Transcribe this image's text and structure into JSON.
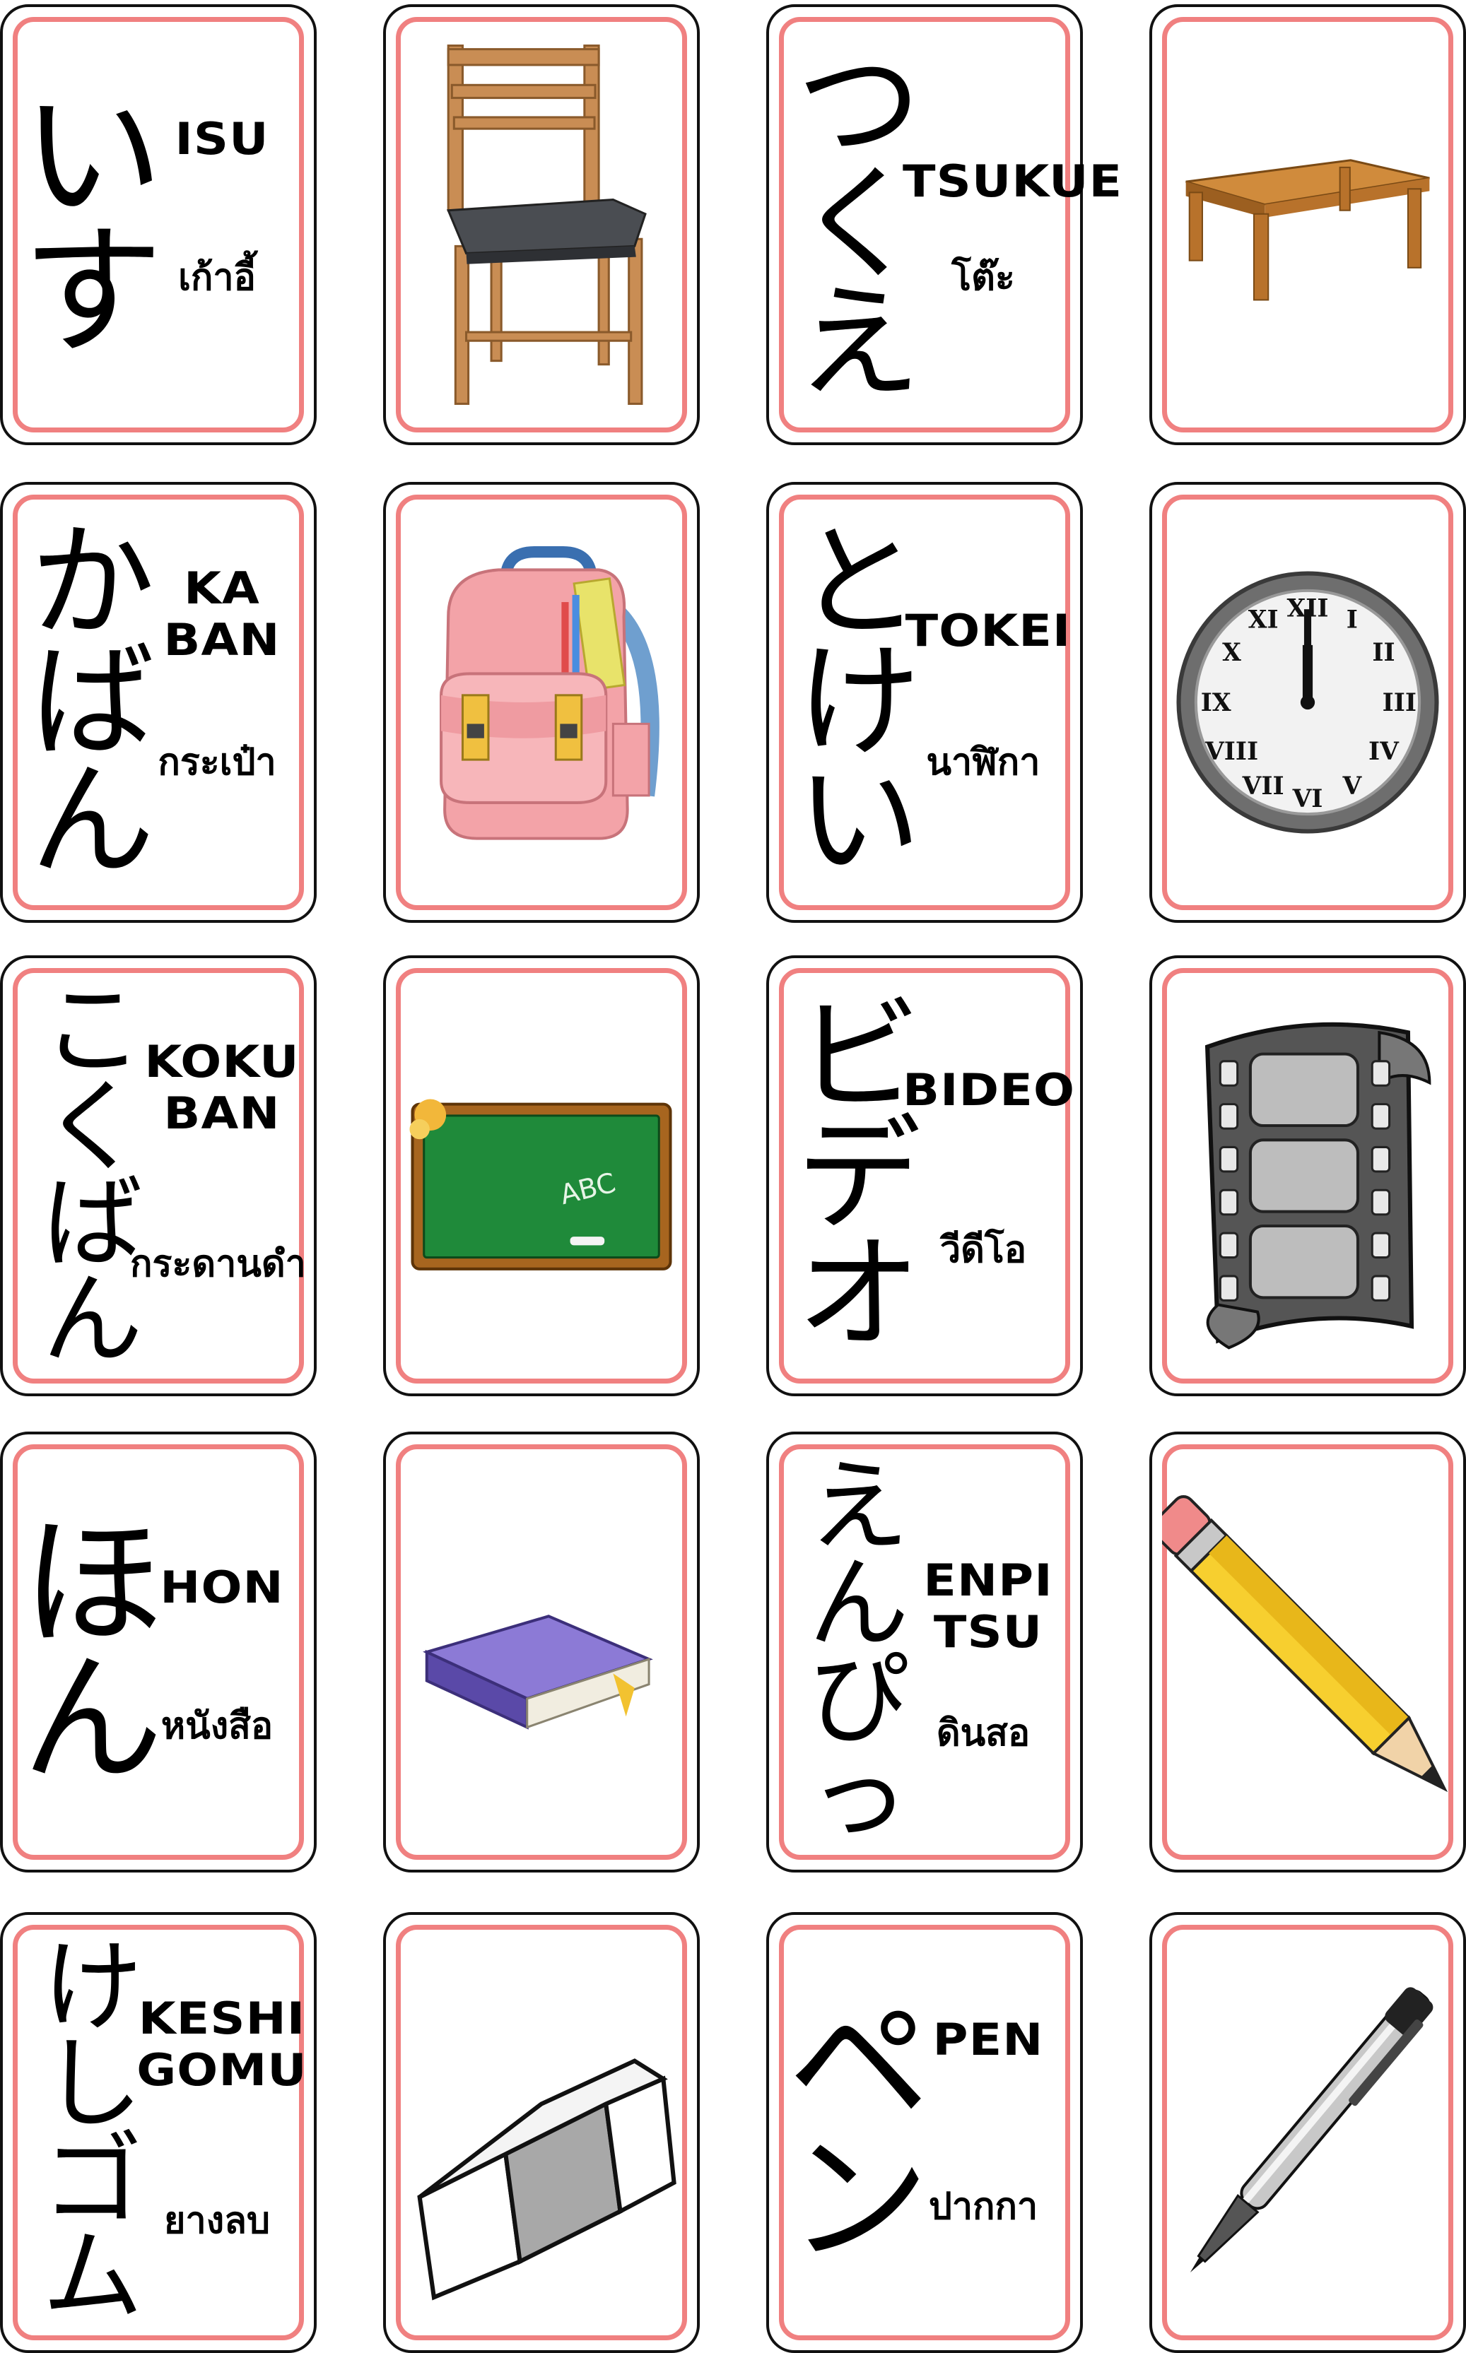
{
  "cards": [
    {
      "kana": [
        "い",
        "す"
      ],
      "romaji": "ISU",
      "thai": "เก้าอี้",
      "image": "chair-icon"
    },
    {
      "kana": [
        "つ",
        "く",
        "え"
      ],
      "romaji": "TSUKUE",
      "thai": "โต๊ะ",
      "image": "desk-icon"
    },
    {
      "kana": [
        "か",
        "ば",
        "ん"
      ],
      "romaji": "KA\nBAN",
      "thai": "กระเป๋า",
      "image": "backpack-icon"
    },
    {
      "kana": [
        "と",
        "け",
        "い"
      ],
      "romaji": "TOKEI",
      "thai": "นาฬิกา",
      "image": "clock-icon"
    },
    {
      "kana": [
        "こ",
        "く",
        "ば",
        "ん"
      ],
      "romaji": "KOKU\nBAN",
      "thai": "กระดานดำ",
      "image": "blackboard-icon"
    },
    {
      "kana": [
        "ビ",
        "デ",
        "オ"
      ],
      "romaji": "BIDEO",
      "thai": "วีดีโอ",
      "image": "film-strip-icon"
    },
    {
      "kana": [
        "ほ",
        "ん"
      ],
      "romaji": "HON",
      "thai": "หนังสือ",
      "image": "book-icon"
    },
    {
      "kana": [
        "え",
        "ん",
        "ぴ",
        "っ"
      ],
      "romaji": "ENPI\nTSU",
      "thai": "ดินสอ",
      "image": "pencil-icon"
    },
    {
      "kana": [
        "け",
        "し",
        "ゴ",
        "ム"
      ],
      "romaji": "KESHI\nGOMU",
      "thai": "ยางลบ",
      "image": "eraser-icon"
    },
    {
      "kana": [
        "ペ",
        "ン"
      ],
      "romaji": "PEN",
      "thai": "ปากกา",
      "image": "pen-icon"
    }
  ]
}
